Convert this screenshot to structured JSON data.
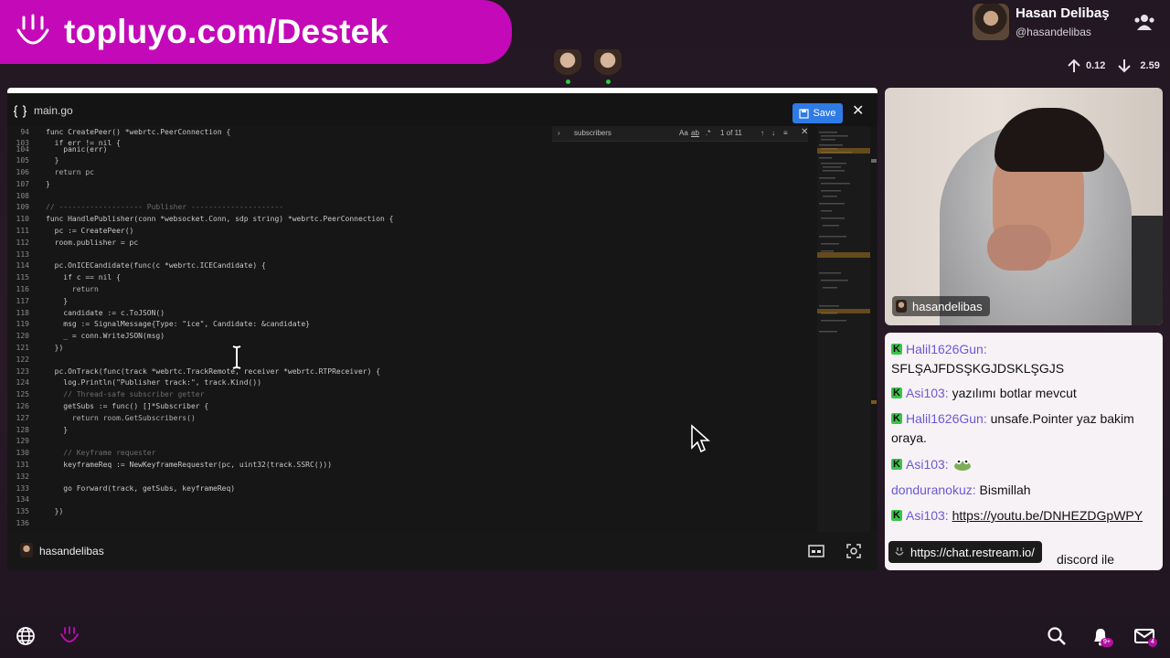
{
  "banner": {
    "text": "topluyo.com/Destek"
  },
  "profile": {
    "name": "Hasan Delibaş",
    "handle": "@hasandelibas"
  },
  "stats": {
    "upload": "0.12",
    "download": "2.59"
  },
  "editor": {
    "filename": "main.go",
    "save_label": "Save",
    "find": {
      "query": "subscribers",
      "case_label": "Aa",
      "word_label": "ab",
      "regex_label": ".*",
      "count": "1 of 11"
    },
    "lines": [
      {
        "n": "94",
        "text": "func CreatePeer() *webrtc.PeerConnection {"
      },
      {
        "n": "103",
        "text": "  if err != nil {"
      },
      {
        "n": "104",
        "text": "    panic(err)"
      },
      {
        "n": "105",
        "text": "  }"
      },
      {
        "n": "106",
        "text": "  return pc"
      },
      {
        "n": "107",
        "text": "}"
      },
      {
        "n": "108",
        "text": ""
      },
      {
        "n": "109",
        "text": "// ------------------- Publisher ---------------------"
      },
      {
        "n": "110",
        "text": "func HandlePublisher(conn *websocket.Conn, sdp string) *webrtc.PeerConnection {"
      },
      {
        "n": "111",
        "text": "  pc := CreatePeer()"
      },
      {
        "n": "112",
        "text": "  room.publisher = pc"
      },
      {
        "n": "113",
        "text": ""
      },
      {
        "n": "114",
        "text": "  pc.OnICECandidate(func(c *webrtc.ICECandidate) {"
      },
      {
        "n": "115",
        "text": "    if c == nil {"
      },
      {
        "n": "116",
        "text": "      return"
      },
      {
        "n": "117",
        "text": "    }"
      },
      {
        "n": "118",
        "text": "    candidate := c.ToJSON()"
      },
      {
        "n": "119",
        "text": "    msg := SignalMessage{Type: \"ice\", Candidate: &candidate}"
      },
      {
        "n": "120",
        "text": "    _ = conn.WriteJSON(msg)"
      },
      {
        "n": "121",
        "text": "  })"
      },
      {
        "n": "122",
        "text": ""
      },
      {
        "n": "123",
        "text": "  pc.OnTrack(func(track *webrtc.TrackRemote, receiver *webrtc.RTPReceiver) {"
      },
      {
        "n": "124",
        "text": "    log.Println(\"Publisher track:\", track.Kind())"
      },
      {
        "n": "125",
        "text": "    // Thread-safe subscriber getter"
      },
      {
        "n": "126",
        "text": "    getSubs := func() []*Subscriber {"
      },
      {
        "n": "127",
        "text": "      return room.GetSubscribers()"
      },
      {
        "n": "128",
        "text": "    }"
      },
      {
        "n": "129",
        "text": ""
      },
      {
        "n": "130",
        "text": "    // Keyframe requester"
      },
      {
        "n": "131",
        "text": "    keyframeReq := NewKeyframeRequester(pc, uint32(track.SSRC()))"
      },
      {
        "n": "132",
        "text": ""
      },
      {
        "n": "133",
        "text": "    go Forward(track, getSubs, keyframeReq)"
      },
      {
        "n": "134",
        "text": ""
      },
      {
        "n": "135",
        "text": "  })"
      },
      {
        "n": "136",
        "text": ""
      }
    ],
    "bottom_user": "hasandelibas"
  },
  "cam": {
    "label": "hasandelibas"
  },
  "chat": {
    "messages": [
      {
        "user": "Halil1626Gun:",
        "text": "SFLŞAJFDSŞKGJDSKLŞGJS",
        "link": ""
      },
      {
        "user": "Asi103:",
        "text": "yazılımı botlar mevcut",
        "link": ""
      },
      {
        "user": "Halil1626Gun:",
        "text": "unsafe.Pointer yaz bakim oraya.",
        "link": ""
      },
      {
        "user": "Asi103:",
        "text": "",
        "link": ""
      },
      {
        "user": "donduranokuz:",
        "text": "Bismillah",
        "link": ""
      },
      {
        "user": "Asi103:",
        "text": "",
        "link": "https://youtu.be/DNHEZDGpWPY"
      }
    ],
    "url_bar": "https://chat.restream.io/",
    "partial_text": "discord ile"
  },
  "icons": {
    "globe": "globe-icon",
    "smile": "smile-icon",
    "search": "search-icon",
    "bell": "bell-icon",
    "mail": "mail-icon"
  },
  "badges": {
    "notifications": "9+",
    "mail": "4"
  },
  "colors": {
    "banner": "#c409b8",
    "save": "#2f7be6",
    "kick_green": "#3bc24a",
    "chat_user": "#6a59d6"
  }
}
